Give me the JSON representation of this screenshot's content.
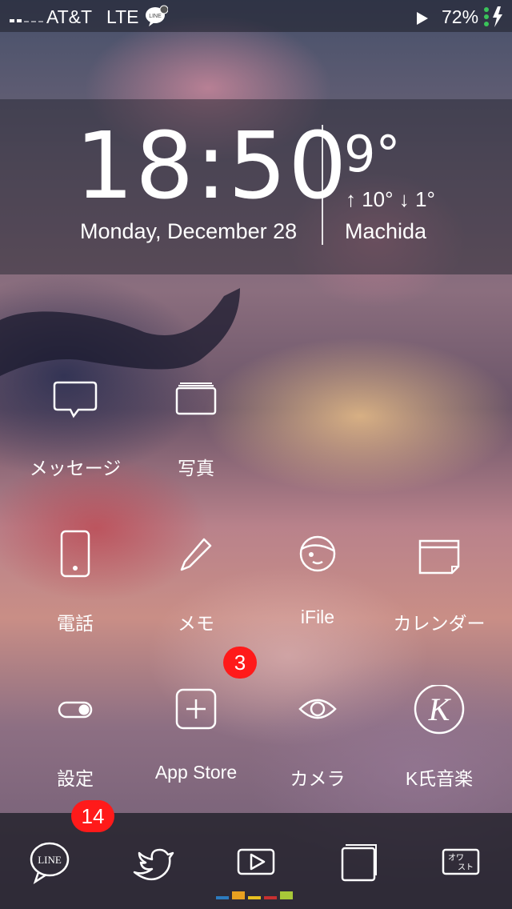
{
  "status_bar": {
    "carrier": "AT&T",
    "network": "LTE",
    "line_icon_text": "LINE",
    "battery": "72%"
  },
  "widget": {
    "time": "18:50",
    "date": "Monday, December 28",
    "temperature": "9°",
    "hi_lo": "↑ 10° ↓ 1°",
    "city": "Machida"
  },
  "apps": {
    "row1": [
      {
        "label": "メッセージ",
        "icon": "message-icon"
      },
      {
        "label": "写真",
        "icon": "photos-icon"
      }
    ],
    "row2": [
      {
        "label": "電話",
        "icon": "phone-icon"
      },
      {
        "label": "メモ",
        "icon": "pencil-icon"
      },
      {
        "label": "iFile",
        "icon": "ifile-icon"
      },
      {
        "label": "カレンダー",
        "icon": "calendar-icon"
      }
    ],
    "row3": [
      {
        "label": "設定",
        "icon": "toggle-icon"
      },
      {
        "label": "App Store",
        "icon": "plus-icon",
        "badge": "3"
      },
      {
        "label": "カメラ",
        "icon": "eye-icon"
      },
      {
        "label": "K氏音楽",
        "icon": "k-music-icon",
        "glyph": "K"
      }
    ]
  },
  "dock": {
    "items": [
      {
        "icon": "line-icon",
        "text": "LINE",
        "badge": "14"
      },
      {
        "icon": "twitter-icon"
      },
      {
        "icon": "video-play-icon"
      },
      {
        "icon": "cards-icon"
      },
      {
        "icon": "owasto-icon",
        "text_top": "オワ",
        "text_bottom": "スト"
      }
    ]
  },
  "colors": {
    "badge": "#ff1a1a",
    "pager": [
      "#2c7bbf",
      "#e8a020",
      "#e8c020",
      "#c83030",
      "#a8c838"
    ]
  }
}
